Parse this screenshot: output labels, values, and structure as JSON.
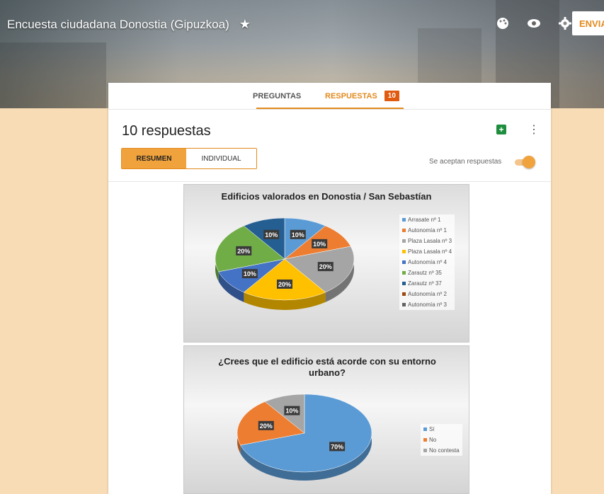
{
  "header": {
    "title": "Encuesta ciudadana Donostia (Gipuzkoa)",
    "send_label": "ENVIA"
  },
  "tabs": {
    "questions": "PREGUNTAS",
    "responses": "RESPUESTAS",
    "responses_count": "10"
  },
  "summary": {
    "title": "10 respuestas",
    "seg_summary": "RESUMEN",
    "seg_individual": "INDIVIDUAL",
    "accepting": "Se aceptan respuestas"
  },
  "chart_data": [
    {
      "type": "pie",
      "title": "Edificios valorados en Donostia / San Sebastían",
      "categories": [
        "Arrasate nº 1",
        "Autonomía nº 1",
        "Plaza Lasala nº 3",
        "Plaza Lasala nº 4",
        "Autonomía nº 4",
        "Zarautz nº 35",
        "Zarautz nº 37",
        "Autonomía nº 2",
        "Autonomía nº 3"
      ],
      "values": [
        10,
        10,
        20,
        20,
        10,
        20,
        10,
        0,
        0
      ],
      "labels": [
        "10%",
        "10%",
        "20%",
        "20%",
        "10%",
        "20%",
        "10%",
        "",
        ""
      ],
      "colors": [
        "#5b9bd5",
        "#ed7d31",
        "#a5a5a5",
        "#ffc000",
        "#4472c4",
        "#70ad47",
        "#255e91",
        "#9e480e",
        "#636363"
      ],
      "legend_position": "right"
    },
    {
      "type": "pie",
      "title": "¿Crees que el edificio está acorde con su entorno urbano?",
      "categories": [
        "Sí",
        "No",
        "No contesta"
      ],
      "values": [
        70,
        20,
        10
      ],
      "labels": [
        "70%",
        "20%",
        "10%"
      ],
      "colors": [
        "#5b9bd5",
        "#ed7d31",
        "#a5a5a5"
      ],
      "legend_position": "right"
    }
  ]
}
